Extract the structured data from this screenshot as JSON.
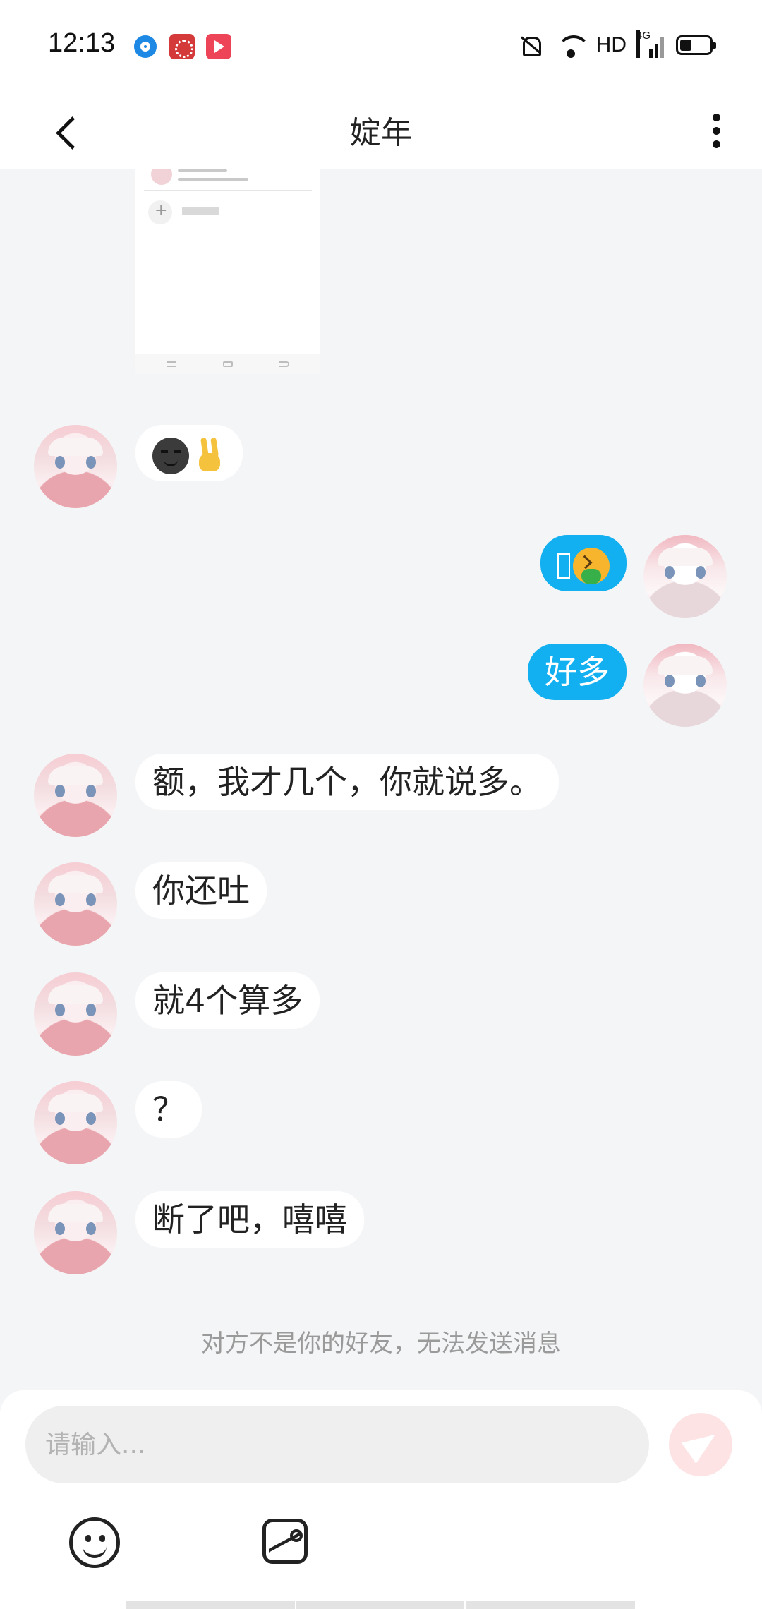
{
  "status_bar": {
    "time": "12:13",
    "network": "HD",
    "network_type": "4G",
    "icons": [
      "app-notification-icon",
      "app-notification-icon",
      "app-notification-icon",
      "mute-icon",
      "wifi-icon",
      "signal-icon",
      "battery-icon"
    ]
  },
  "header": {
    "title": "婝年",
    "back_icon": "back-arrow-icon",
    "more_icon": "more-vertical-icon"
  },
  "messages": [
    {
      "from": "them",
      "type": "image",
      "text": ""
    },
    {
      "from": "them",
      "type": "emoji",
      "text": "",
      "emojis": [
        "smirk-emoji",
        "victory-hand-emoji"
      ]
    },
    {
      "from": "me",
      "type": "emoji",
      "text": "",
      "emojis": [
        "missing-glyph",
        "vomiting-face-emoji"
      ]
    },
    {
      "from": "me",
      "type": "text",
      "text": "好多"
    },
    {
      "from": "them",
      "type": "text",
      "text": "额，我才几个，你就说多。"
    },
    {
      "from": "them",
      "type": "text",
      "text": "你还吐"
    },
    {
      "from": "them",
      "type": "text",
      "text": "就4个算多"
    },
    {
      "from": "them",
      "type": "text",
      "text": "？"
    },
    {
      "from": "them",
      "type": "text",
      "text": "断了吧，嘻嘻"
    }
  ],
  "notice": "对方不是你的好友，无法发送消息",
  "input": {
    "placeholder": "请输入...",
    "value": ""
  },
  "toolbar": {
    "emoji_icon": "smiley-icon",
    "image_icon": "image-icon",
    "send_icon": "send-icon"
  },
  "colors": {
    "accent": "#12b0f0",
    "background": "#f4f5f7",
    "send_button": "#fde3e3"
  }
}
